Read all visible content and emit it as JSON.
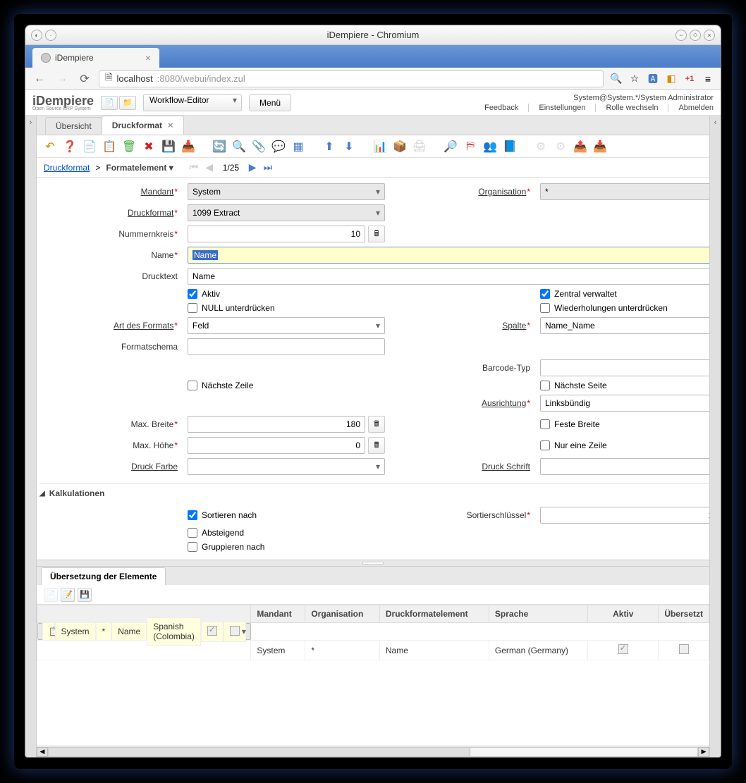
{
  "window": {
    "title": "iDempiere - Chromium"
  },
  "browser": {
    "tab_title": "iDempiere",
    "url_host": "localhost",
    "url_path": ":8080/webui/index.zul"
  },
  "header": {
    "logo": "iDempiere",
    "logo_sub": "Open Source ERP System",
    "selector": "Workflow-Editor",
    "menu_btn": "Menü",
    "user_info": "System@System.*/System Administrator",
    "links": {
      "feedback": "Feedback",
      "settings": "Einstellungen",
      "switch_role": "Rolle wechseln",
      "logout": "Abmelden"
    }
  },
  "tabs": {
    "overview": "Übersicht",
    "active": "Druckformat"
  },
  "breadcrumb": {
    "root": "Druckformat",
    "sep": ">",
    "current": "Formatelement",
    "record": "1/25"
  },
  "form": {
    "labels": {
      "mandant": "Mandant",
      "organisation": "Organisation",
      "druckformat": "Druckformat",
      "nummernkreis": "Nummernkreis",
      "name": "Name",
      "drucktext": "Drucktext",
      "aktiv": "Aktiv",
      "zentral": "Zentral verwaltet",
      "null_suppress": "NULL unterdrücken",
      "repeat_suppress": "Wiederholungen unterdrücken",
      "art_format": "Art des Formats",
      "spalte": "Spalte",
      "formatschema": "Formatschema",
      "barcode": "Barcode-Typ",
      "next_line": "Nächste Zeile",
      "next_page": "Nächste Seite",
      "ausrichtung": "Ausrichtung",
      "max_breite": "Max. Breite",
      "feste_breite": "Feste Breite",
      "max_hoehe": "Max. Höhe",
      "nur_eine_zeile": "Nur eine Zeile",
      "druck_farbe": "Druck Farbe",
      "druck_schrift": "Druck Schrift",
      "section_kalk": "Kalkulationen",
      "sortieren": "Sortieren nach",
      "sortierschluessel": "Sortierschlüssel",
      "absteigend": "Absteigend",
      "gruppieren": "Gruppieren nach"
    },
    "values": {
      "mandant": "System",
      "organisation": "*",
      "druckformat": "1099 Extract",
      "nummernkreis": "10",
      "name": "Name",
      "drucktext": "Name",
      "art_format": "Feld",
      "spalte": "Name_Name",
      "ausrichtung": "Linksbündig",
      "max_breite": "180",
      "max_hoehe": "0",
      "sortierschluessel": "1"
    },
    "checks": {
      "aktiv": true,
      "zentral": true,
      "null_suppress": false,
      "repeat_suppress": false,
      "next_line": false,
      "next_page": false,
      "feste_breite": false,
      "nur_eine_zeile": false,
      "sortieren": true,
      "absteigend": false,
      "gruppieren": false
    }
  },
  "bottom": {
    "tab": "Übersetzung der Elemente",
    "columns": {
      "mandant": "Mandant",
      "organisation": "Organisation",
      "element": "Druckformatelement",
      "sprache": "Sprache",
      "aktiv": "Aktiv",
      "uebersetzt": "Übersetzt"
    },
    "rows": [
      {
        "mandant": "System",
        "organisation": "*",
        "element": "Name",
        "sprache": "Spanish (Colombia)",
        "aktiv": true
      },
      {
        "mandant": "System",
        "organisation": "*",
        "element": "Name",
        "sprache": "German (Germany)",
        "aktiv": true
      }
    ]
  }
}
